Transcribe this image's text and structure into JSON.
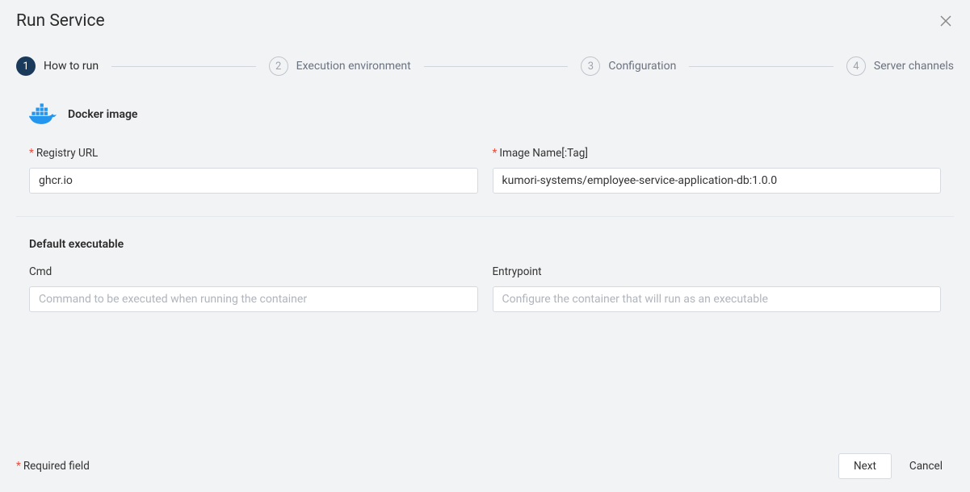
{
  "header": {
    "title": "Run Service"
  },
  "stepper": {
    "steps": [
      {
        "num": "1",
        "label": "How to run",
        "active": true
      },
      {
        "num": "2",
        "label": "Execution environment",
        "active": false
      },
      {
        "num": "3",
        "label": "Configuration",
        "active": false
      },
      {
        "num": "4",
        "label": "Server channels",
        "active": false
      }
    ]
  },
  "docker": {
    "section_title": "Docker image",
    "registry": {
      "label": "Registry URL",
      "value": "ghcr.io"
    },
    "image": {
      "label": "Image Name[:Tag]",
      "value": "kumori-systems/employee-service-application-db:1.0.0"
    }
  },
  "executable": {
    "section_title": "Default executable",
    "cmd": {
      "label": "Cmd",
      "placeholder": "Command to be executed when running the container",
      "value": ""
    },
    "entrypoint": {
      "label": "Entrypoint",
      "placeholder": "Configure the container that will run as an executable",
      "value": ""
    }
  },
  "footer": {
    "required_text": "Required field",
    "next": "Next",
    "cancel": "Cancel"
  }
}
